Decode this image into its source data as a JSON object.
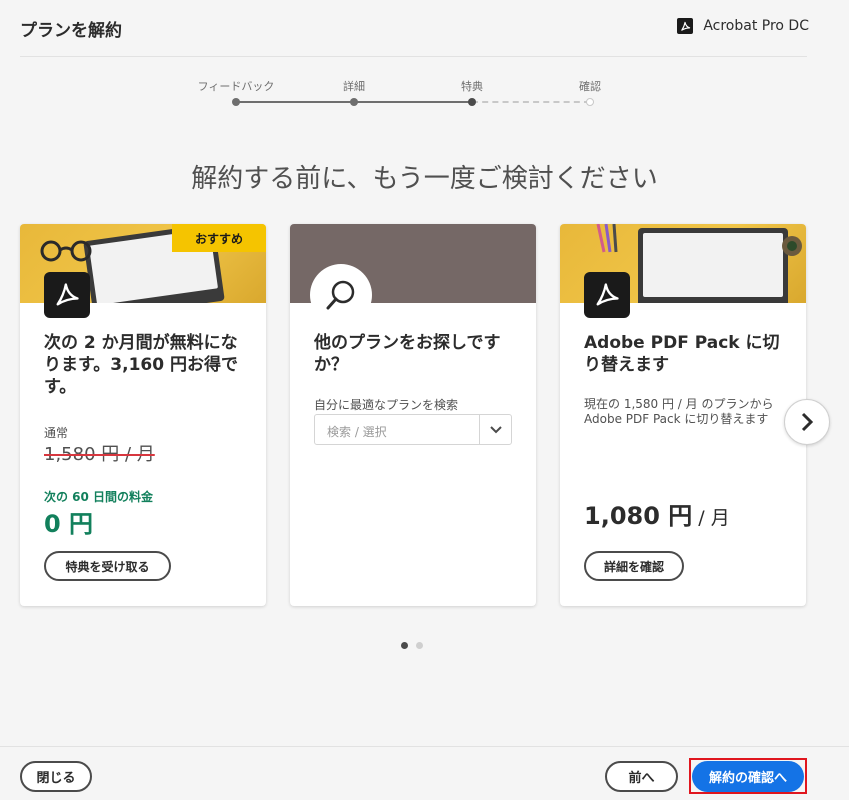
{
  "header": {
    "title": "プランを解約",
    "product": "Acrobat Pro DC"
  },
  "steps": [
    {
      "label": "フィードバック",
      "state": "done"
    },
    {
      "label": "詳細",
      "state": "done"
    },
    {
      "label": "特典",
      "state": "current"
    },
    {
      "label": "確認",
      "state": "pending"
    }
  ],
  "headline": "解約する前に、もう一度ご検討ください",
  "cards": [
    {
      "badge": "おすすめ",
      "title": "次の 2 か月間が無料になります。3,160 円お得です。",
      "regular_label": "通常",
      "regular_price": "1,580 円 / 月",
      "promo_label": "次の 60 日間の料金",
      "promo_price": "0 円",
      "button": "特典を受け取る"
    },
    {
      "title": "他のプランをお探しですか？",
      "search_label": "自分に最適なプランを検索",
      "select_value": "検索 / 選択"
    },
    {
      "title": "Adobe PDF Pack に切り替えます",
      "description": "現在の 1,580 円 / 月 のプランから Adobe PDF Pack に切り替えます",
      "price": "1,080 円",
      "price_unit": "/ 月",
      "button": "詳細を確認"
    }
  ],
  "pager": {
    "count": 2,
    "active": 1
  },
  "footer": {
    "close": "閉じる",
    "back": "前へ",
    "confirm": "解約の確認へ"
  },
  "colors": {
    "primary": "#1473e6",
    "promo_green": "#12805c",
    "badge_yellow": "#f5c400",
    "highlight_red": "#e0161e"
  }
}
